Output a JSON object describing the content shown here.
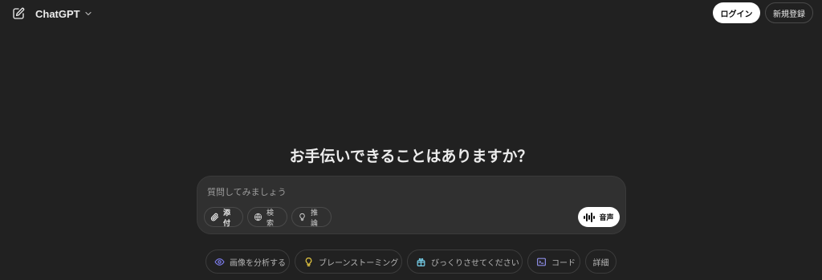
{
  "header": {
    "new_chat_icon": "edit-pencil-icon",
    "model_name": "ChatGPT",
    "model_chevron_icon": "chevron-down-icon",
    "login_label": "ログイン",
    "signup_label": "新規登録"
  },
  "hero": {
    "title": "お手伝いできることはありますか？"
  },
  "composer": {
    "placeholder": "質問してみましょう",
    "value": "",
    "tools": [
      {
        "label": "添付",
        "icon": "paperclip-icon"
      },
      {
        "label": "検索",
        "icon": "globe-icon"
      },
      {
        "label": "推論",
        "icon": "lightbulb-icon"
      }
    ],
    "voice": {
      "label": "音声",
      "icon": "waveform-icon"
    }
  },
  "suggestions": [
    {
      "label": "画像を分析する",
      "icon": "eye-icon",
      "color": "#7b7bea"
    },
    {
      "label": "ブレーンストーミング",
      "icon": "lightbulb-icon",
      "color": "#e2c541"
    },
    {
      "label": "びっくりさせてください",
      "icon": "gift-icon",
      "color": "#76d0eb"
    },
    {
      "label": "コード",
      "icon": "code-icon",
      "color": "#8e8ee6"
    },
    {
      "label": "詳細",
      "icon": "",
      "color": "#b4b4b4"
    }
  ],
  "colors": {
    "background": "#212121",
    "composer_bg": "#303030",
    "text": "#ececec",
    "muted_text": "#9b9b9b",
    "button_primary_bg": "#ffffff"
  }
}
